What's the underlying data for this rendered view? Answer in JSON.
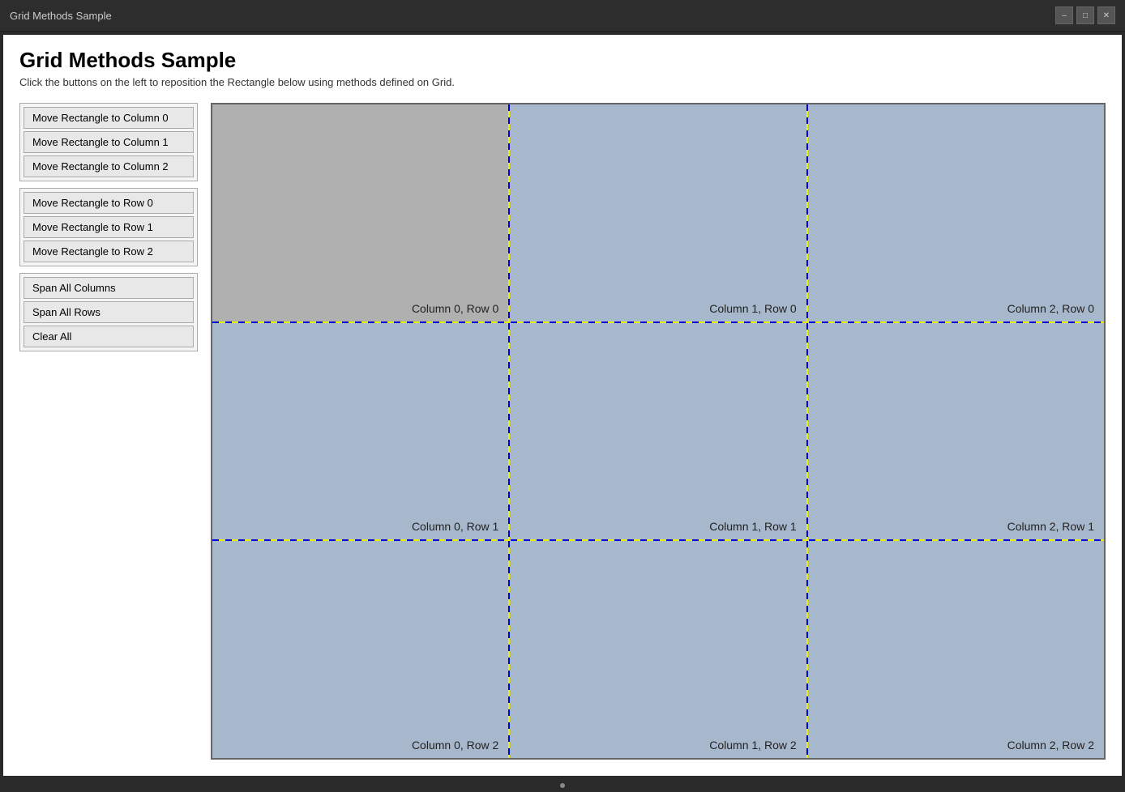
{
  "titleBar": {
    "title": "Grid Methods Sample",
    "controls": [
      "minimize",
      "maximize",
      "close"
    ]
  },
  "header": {
    "title": "Grid Methods Sample",
    "subtitle": "Click the buttons on the left to reposition the Rectangle below using methods defined on Grid."
  },
  "buttonGroups": [
    {
      "id": "column-group",
      "buttons": [
        {
          "id": "col0",
          "label": "Move Rectangle to Column 0"
        },
        {
          "id": "col1",
          "label": "Move Rectangle to Column 1"
        },
        {
          "id": "col2",
          "label": "Move Rectangle to Column 2"
        }
      ]
    },
    {
      "id": "row-group",
      "buttons": [
        {
          "id": "row0",
          "label": "Move Rectangle to Row 0"
        },
        {
          "id": "row1",
          "label": "Move Rectangle to Row 1"
        },
        {
          "id": "row2",
          "label": "Move Rectangle to Row 2"
        }
      ]
    },
    {
      "id": "span-group",
      "buttons": [
        {
          "id": "span-cols",
          "label": "Span All Columns"
        },
        {
          "id": "span-rows",
          "label": "Span All Rows"
        },
        {
          "id": "clear-all",
          "label": "Clear All"
        }
      ]
    }
  ],
  "gridCells": [
    {
      "col": 1,
      "row": 1,
      "label": "Column 0, Row 0",
      "isRectangle": true
    },
    {
      "col": 3,
      "row": 1,
      "label": "Column 1, Row 0",
      "isRectangle": false
    },
    {
      "col": 5,
      "row": 1,
      "label": "Column 2, Row 0",
      "isRectangle": false
    },
    {
      "col": 1,
      "row": 3,
      "label": "Column 0, Row 1",
      "isRectangle": false
    },
    {
      "col": 3,
      "row": 3,
      "label": "Column 1, Row 1",
      "isRectangle": false
    },
    {
      "col": 5,
      "row": 3,
      "label": "Column 2, Row 1",
      "isRectangle": false
    },
    {
      "col": 1,
      "row": 5,
      "label": "Column 0, Row 2",
      "isRectangle": false
    },
    {
      "col": 3,
      "row": 5,
      "label": "Column 1, Row 2",
      "isRectangle": false
    },
    {
      "col": 5,
      "row": 5,
      "label": "Column 2, Row 2",
      "isRectangle": false
    }
  ]
}
